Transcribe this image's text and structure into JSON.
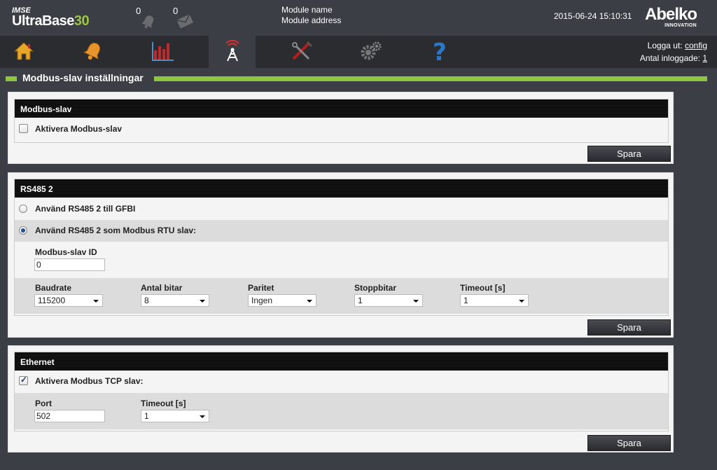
{
  "header": {
    "brand_small": "IMSE",
    "brand_name": "UltraBase",
    "brand_num": "30",
    "alarm_count": "0",
    "message_count": "0",
    "module_name": "Module name",
    "module_address": "Module address",
    "datetime": "2015-06-24 15:10:31",
    "logo_main": "Abelko",
    "logo_sub": "INNOVATION"
  },
  "nav": {
    "items": [
      "home-icon",
      "alarm-bell-icon",
      "bar-chart-icon",
      "antenna-icon",
      "tools-icon",
      "gears-icon",
      "help-icon"
    ],
    "active": "antenna-icon",
    "logout_label": "Logga ut:",
    "logout_user": "config",
    "logged_in_label": "Antal inloggade:",
    "logged_in_count": "1"
  },
  "page": {
    "title": "Modbus-slav inställningar"
  },
  "modbus_slave": {
    "header": "Modbus-slav",
    "enable_label": "Aktivera Modbus-slav",
    "enabled": false,
    "save_label": "Spara"
  },
  "rs485": {
    "header": "RS485 2",
    "option_gfbi": "Använd RS485 2 till GFBI",
    "option_rtu": "Använd RS485 2 som Modbus RTU slav:",
    "selected": "rtu",
    "slave_id_label": "Modbus-slav ID",
    "slave_id_value": "0",
    "baudrate_label": "Baudrate",
    "baudrate_value": "115200",
    "bits_label": "Antal bitar",
    "bits_value": "8",
    "parity_label": "Paritet",
    "parity_value": "Ingen",
    "stopbits_label": "Stoppbitar",
    "stopbits_value": "1",
    "timeout_label": "Timeout [s]",
    "timeout_value": "1",
    "save_label": "Spara"
  },
  "ethernet": {
    "header": "Ethernet",
    "enable_label": "Aktivera Modbus TCP slav:",
    "enabled": true,
    "port_label": "Port",
    "port_value": "502",
    "timeout_label": "Timeout [s]",
    "timeout_value": "1",
    "save_label": "Spara"
  },
  "colors": {
    "accent": "#8dc63f",
    "background": "#3b3e45",
    "nav_background": "#2a2c30"
  }
}
